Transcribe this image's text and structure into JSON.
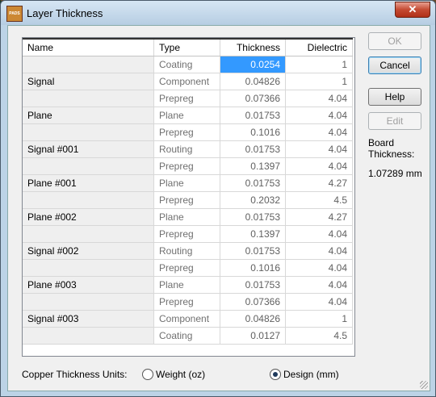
{
  "window": {
    "title": "Layer Thickness",
    "app_icon_label": "PADS",
    "close_glyph": "✕"
  },
  "grid": {
    "columns": [
      "Name",
      "Type",
      "Thickness",
      "Dielectric"
    ],
    "rows": [
      {
        "name": "",
        "type": "Coating",
        "thickness": "0.0254",
        "dielectric": "1",
        "selected": true
      },
      {
        "name": "Signal",
        "type": "Component",
        "thickness": "0.04826",
        "dielectric": "1"
      },
      {
        "name": "",
        "type": "Prepreg",
        "thickness": "0.07366",
        "dielectric": "4.04"
      },
      {
        "name": "Plane",
        "type": "Plane",
        "thickness": "0.01753",
        "dielectric": "4.04"
      },
      {
        "name": "",
        "type": "Prepreg",
        "thickness": "0.1016",
        "dielectric": "4.04"
      },
      {
        "name": "Signal #001",
        "type": "Routing",
        "thickness": "0.01753",
        "dielectric": "4.04"
      },
      {
        "name": "",
        "type": "Prepreg",
        "thickness": "0.1397",
        "dielectric": "4.04"
      },
      {
        "name": "Plane #001",
        "type": "Plane",
        "thickness": "0.01753",
        "dielectric": "4.27"
      },
      {
        "name": "",
        "type": "Prepreg",
        "thickness": "0.2032",
        "dielectric": "4.5"
      },
      {
        "name": "Plane #002",
        "type": "Plane",
        "thickness": "0.01753",
        "dielectric": "4.27"
      },
      {
        "name": "",
        "type": "Prepreg",
        "thickness": "0.1397",
        "dielectric": "4.04"
      },
      {
        "name": "Signal #002",
        "type": "Routing",
        "thickness": "0.01753",
        "dielectric": "4.04"
      },
      {
        "name": "",
        "type": "Prepreg",
        "thickness": "0.1016",
        "dielectric": "4.04"
      },
      {
        "name": "Plane #003",
        "type": "Plane",
        "thickness": "0.01753",
        "dielectric": "4.04"
      },
      {
        "name": "",
        "type": "Prepreg",
        "thickness": "0.07366",
        "dielectric": "4.04"
      },
      {
        "name": "Signal #003",
        "type": "Component",
        "thickness": "0.04826",
        "dielectric": "1"
      },
      {
        "name": "",
        "type": "Coating",
        "thickness": "0.0127",
        "dielectric": "4.5"
      }
    ]
  },
  "buttons": {
    "ok": "OK",
    "cancel": "Cancel",
    "help": "Help",
    "edit": "Edit"
  },
  "board": {
    "label": "Board Thickness:",
    "value": "1.07289 mm"
  },
  "units": {
    "label": "Copper Thickness Units:",
    "options": [
      {
        "label": "Weight (oz)",
        "checked": false
      },
      {
        "label": "Design (mm)",
        "checked": true
      }
    ]
  },
  "colors": {
    "selection": "#3399ff",
    "window_frame": "#bcd3e6",
    "close_button": "#c44a32"
  }
}
